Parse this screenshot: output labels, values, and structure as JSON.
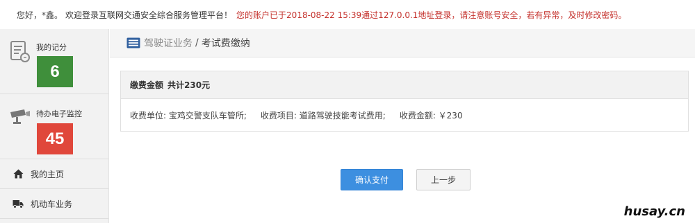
{
  "topbar": {
    "greeting": "您好，",
    "user_name": "*鑫。",
    "welcome": "欢迎登录互联网交通安全综合服务管理平台！",
    "notice": "您的账户已于2018-08-22 15:39通过127.0.0.1地址登录，请注意账号安全，若有异常，及时修改密码。"
  },
  "sidebar": {
    "score": {
      "label": "我的记分",
      "value": "6",
      "color": "#3f8f3b",
      "icon": "score-card-icon"
    },
    "monitor": {
      "label": "待办电子监控",
      "value": "45",
      "color": "#e0473b",
      "icon": "camera-icon"
    },
    "items": [
      {
        "label": "我的主页",
        "icon": "home-icon"
      },
      {
        "label": "机动车业务",
        "icon": "truck-icon"
      }
    ]
  },
  "breadcrumb": {
    "icon": "list-icon",
    "parent": "驾驶证业务",
    "separator": "/",
    "current": "考试费缴纳"
  },
  "payment": {
    "title": "缴费金额",
    "total": "共计230元",
    "unit": "收费单位: 宝鸡交警支队车管所;",
    "item": "收费项目: 道路驾驶技能考试费用;",
    "amount": "收费金额: ￥230"
  },
  "actions": {
    "confirm_label": "确认支付",
    "back_label": "上一步"
  },
  "watermark": "husay.cn"
}
